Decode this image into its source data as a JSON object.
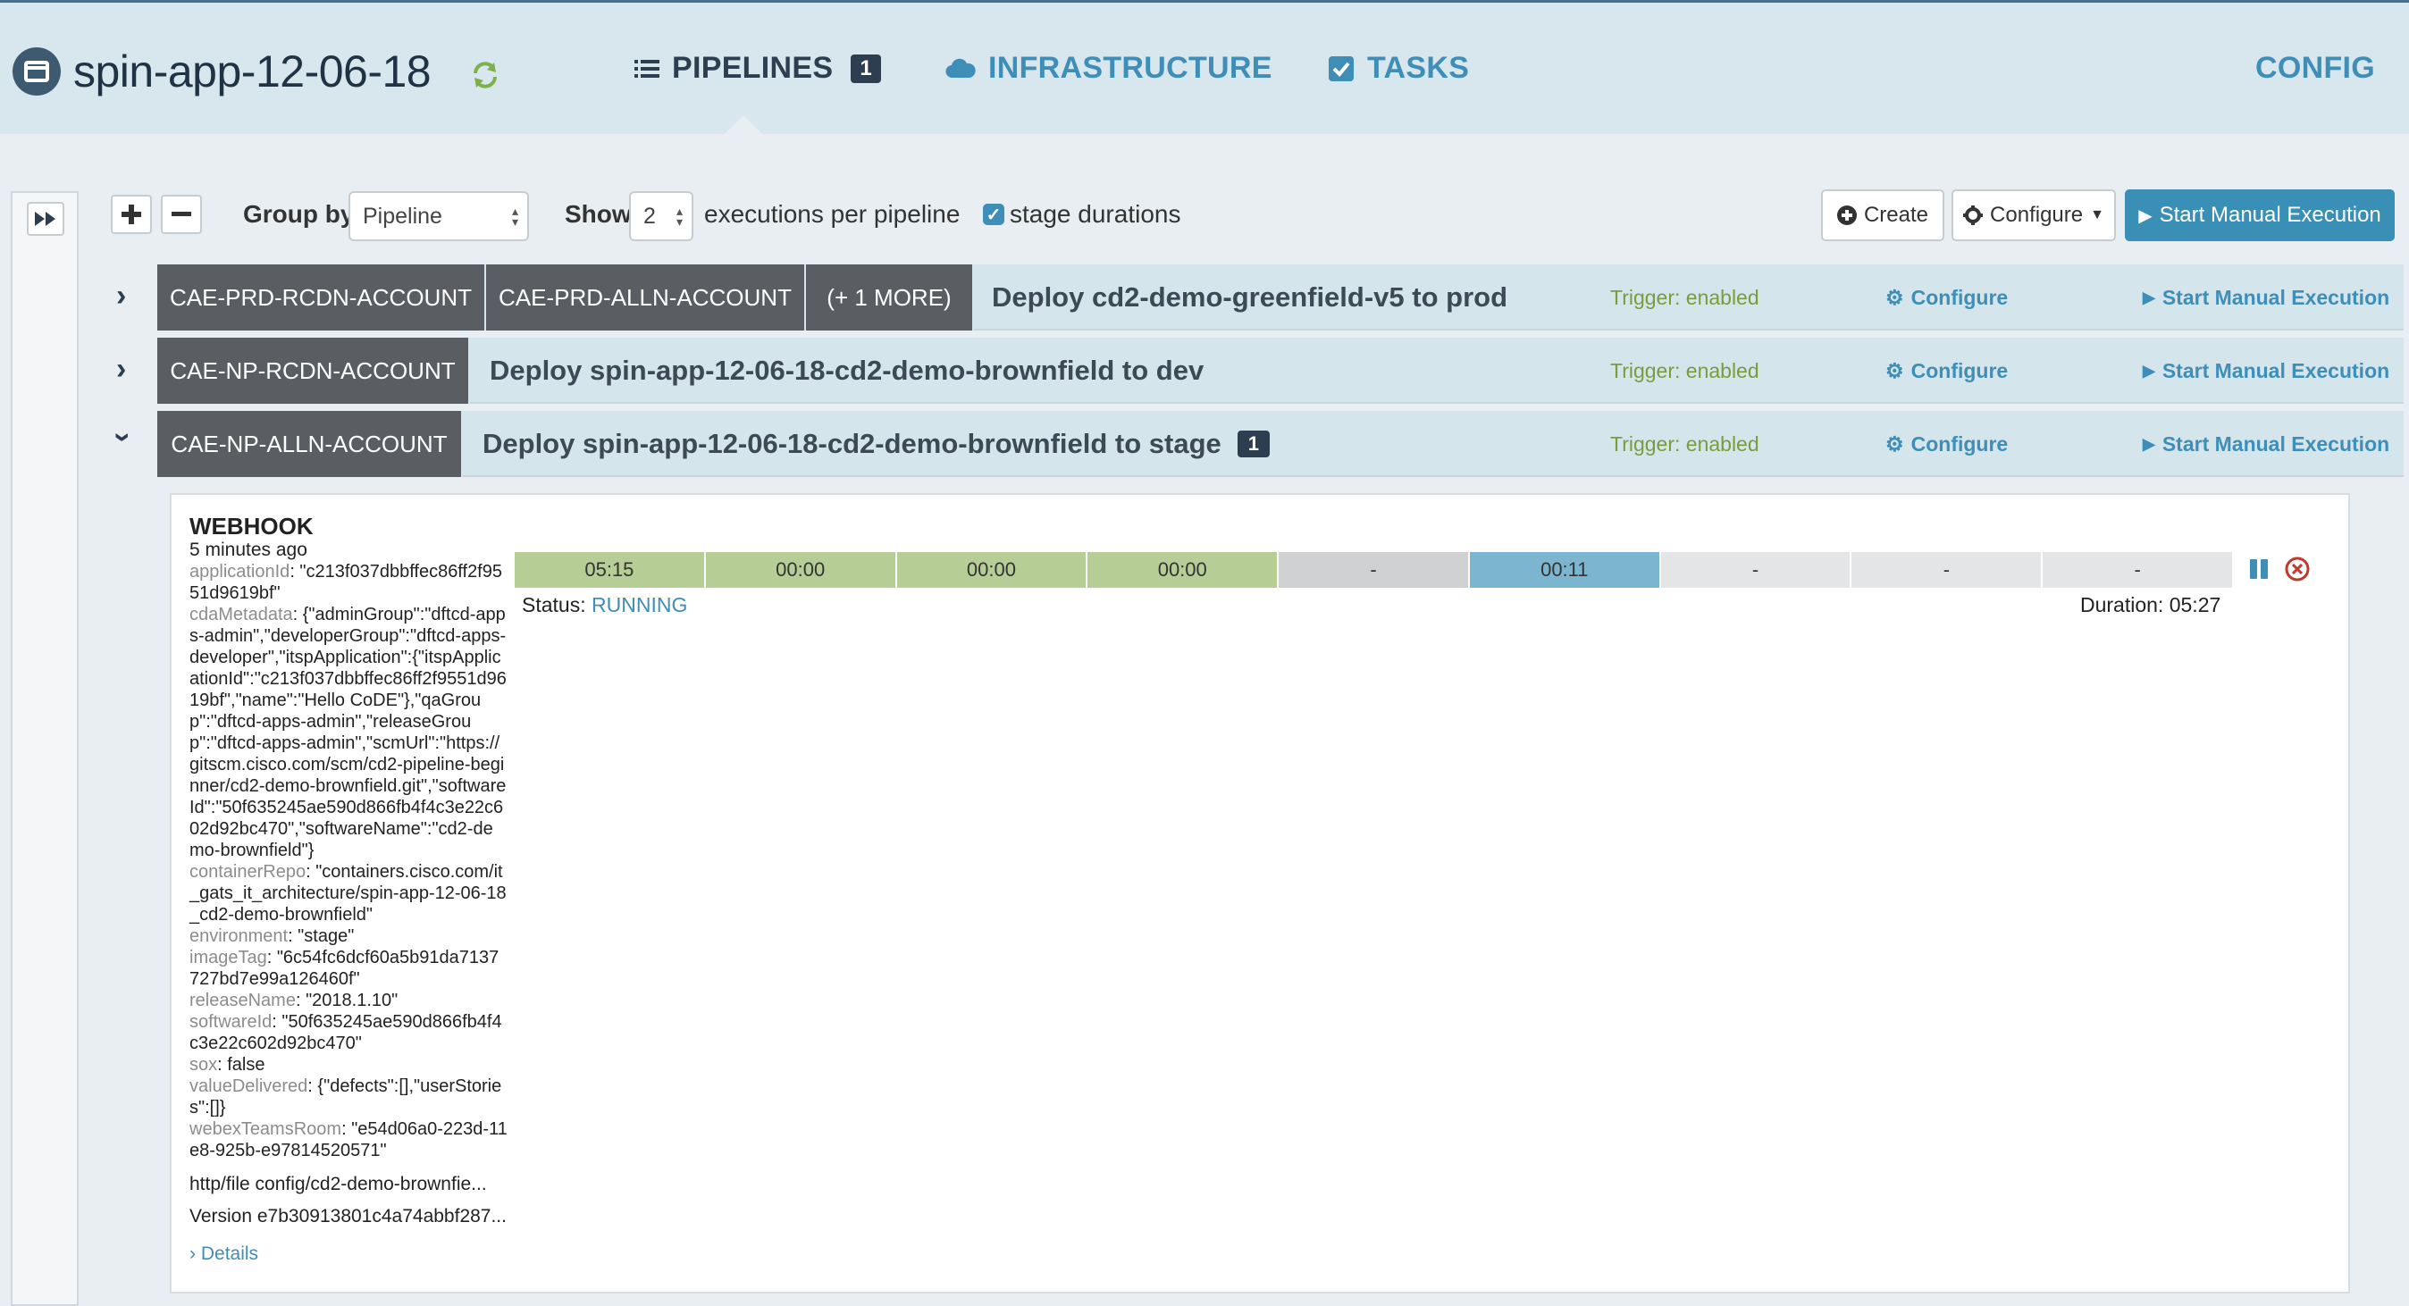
{
  "header": {
    "app_title": "spin-app-12-06-18",
    "tabs": [
      {
        "label": "PIPELINES",
        "badge": "1",
        "active": true
      },
      {
        "label": "INFRASTRUCTURE"
      },
      {
        "label": "TASKS"
      },
      {
        "label": "CONFIG"
      }
    ]
  },
  "toolbar": {
    "group_by_label": "Group by",
    "group_by_value": "Pipeline",
    "show_label": "Show",
    "show_value": "2",
    "executions_label": "executions per pipeline",
    "stage_durations_label": "stage durations",
    "stage_durations_checked": true,
    "create_label": "Create",
    "configure_label": "Configure",
    "start_manual_label": "Start Manual Execution"
  },
  "pipelines": [
    {
      "tags": [
        "CAE-PRD-RCDN-ACCOUNT",
        "CAE-PRD-ALLN-ACCOUNT",
        "(+ 1 MORE)"
      ],
      "name": "Deploy cd2-demo-greenfield-v5 to prod",
      "trigger": "Trigger: enabled",
      "configure": "Configure",
      "start": "Start Manual Execution",
      "expanded": false
    },
    {
      "tags": [
        "CAE-NP-RCDN-ACCOUNT"
      ],
      "name": "Deploy spin-app-12-06-18-cd2-demo-brownfield to dev",
      "trigger": "Trigger: enabled",
      "configure": "Configure",
      "start": "Start Manual Execution",
      "expanded": false
    },
    {
      "tags": [
        "CAE-NP-ALLN-ACCOUNT"
      ],
      "name": "Deploy spin-app-12-06-18-cd2-demo-brownfield to stage",
      "badge": "1",
      "trigger": "Trigger: enabled",
      "configure": "Configure",
      "start": "Start Manual Execution",
      "expanded": true
    }
  ],
  "execution": {
    "trigger_type": "WEBHOOK",
    "time_ago": "5 minutes ago",
    "params": [
      {
        "key": "applicationId",
        "value": ": \"c213f037dbbffec86ff2f9551d9619bf\""
      },
      {
        "key": "cdaMetadata",
        "value": ": {\"adminGroup\":\"dftcd-apps-admin\",\"developerGroup\":\"dftcd-apps-developer\",\"itspApplication\":{\"itspApplicationId\":\"c213f037dbbffec86ff2f9551d9619bf\",\"name\":\"Hello CoDE\"},\"qaGroup\":\"dftcd-apps-admin\",\"releaseGroup\":\"dftcd-apps-admin\",\"scmUrl\":\"https://gitscm.cisco.com/scm/cd2-pipeline-beginner/cd2-demo-brownfield.git\",\"softwareId\":\"50f635245ae590d866fb4f4c3e22c602d92bc470\",\"softwareName\":\"cd2-demo-brownfield\"}"
      },
      {
        "key": "containerRepo",
        "value": ": \"containers.cisco.com/it_gats_it_architecture/spin-app-12-06-18_cd2-demo-brownfield\""
      },
      {
        "key": "environment",
        "value": ": \"stage\""
      },
      {
        "key": "imageTag",
        "value": ": \"6c54fc6dcf60a5b91da7137727bd7e99a126460f\""
      },
      {
        "key": "releaseName",
        "value": ": \"2018.1.10\""
      },
      {
        "key": "softwareId",
        "value": ": \"50f635245ae590d866fb4f4c3e22c602d92bc470\""
      },
      {
        "key": "sox",
        "value": ": false"
      },
      {
        "key": "valueDelivered",
        "value": ": {\"defects\":[],\"userStories\":[]}"
      },
      {
        "key": "webexTeamsRoom",
        "value": ": \"e54d06a0-223d-11e8-925b-e97814520571\""
      }
    ],
    "artifact_file": "http/file  config/cd2-demo-brownfie...",
    "artifact_version": "Version  e7b30913801c4a74abbf287...",
    "details_label": "Details",
    "stages": [
      {
        "label": "05:15",
        "color": "#b7cd96"
      },
      {
        "label": "00:00",
        "color": "#b7cd96"
      },
      {
        "label": "00:00",
        "color": "#b7cd96"
      },
      {
        "label": "00:00",
        "color": "#b7cd96"
      },
      {
        "label": "-",
        "color": "#cfd1d3"
      },
      {
        "label": "00:11",
        "color": "#7bb5cf"
      },
      {
        "label": "-",
        "color": "#e4e5e6"
      },
      {
        "label": "-",
        "color": "#e4e5e6"
      },
      {
        "label": "-",
        "color": "#e4e5e6"
      }
    ],
    "status_label": "Status:",
    "status_value": "RUNNING",
    "duration": "Duration: 05:27"
  }
}
